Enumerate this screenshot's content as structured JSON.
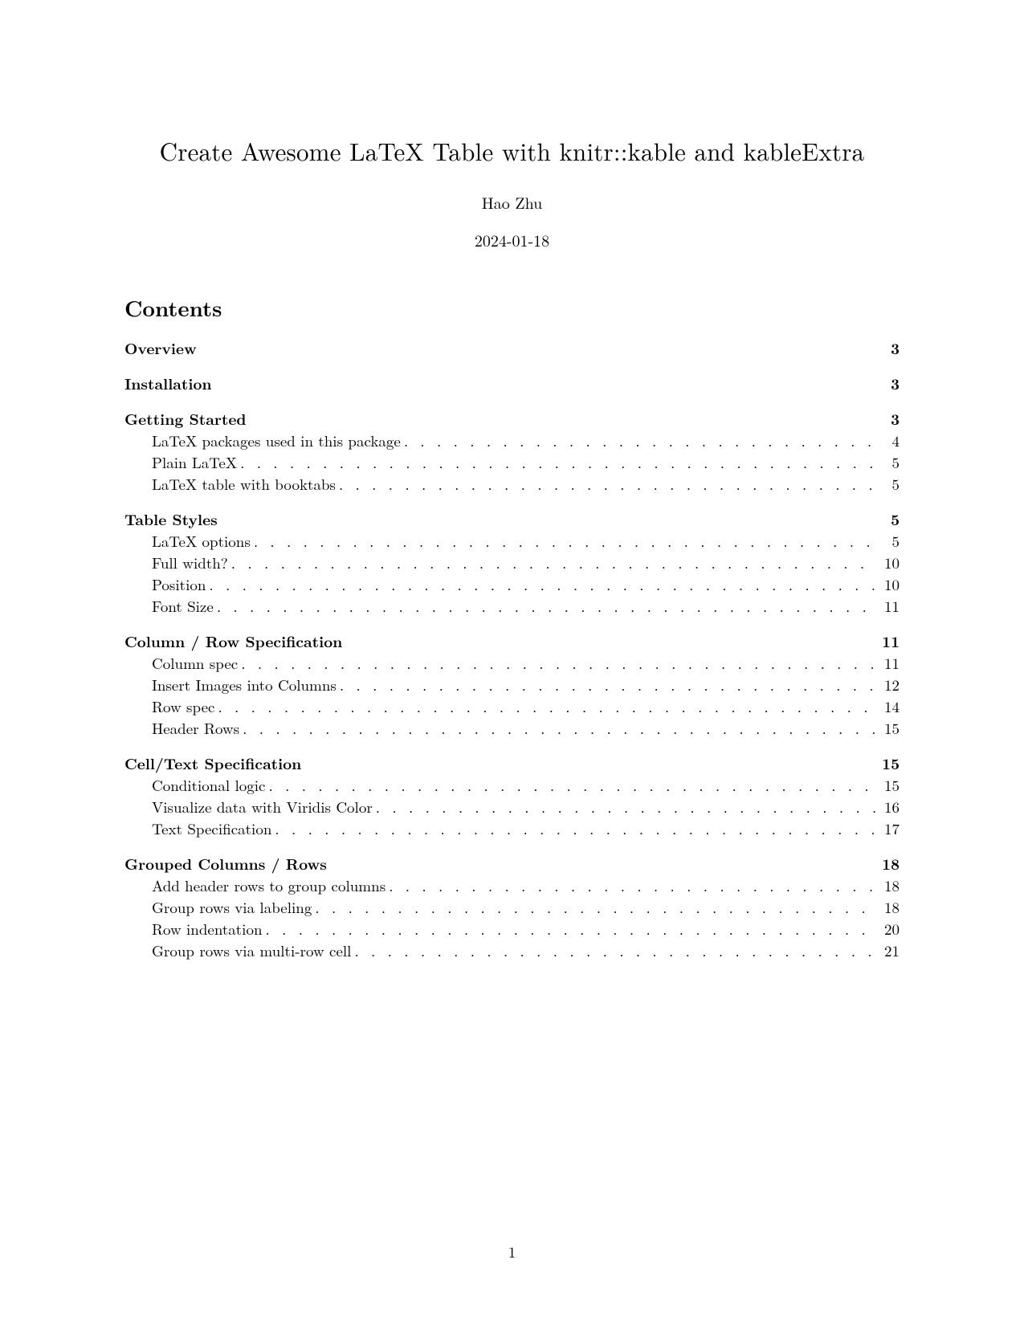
{
  "title": "Create Awesome LaTeX Table with knitr::kable and kableExtra",
  "author": "Hao Zhu",
  "date": "2024-01-18",
  "contents_heading": "Contents",
  "page_number": "1",
  "toc": [
    {
      "type": "section",
      "label": "Overview",
      "page": "3"
    },
    {
      "type": "section",
      "label": "Installation",
      "page": "3"
    },
    {
      "type": "section",
      "label": "Getting Started",
      "page": "3"
    },
    {
      "type": "sub",
      "label": "LaTeX packages used in this package",
      "page": "4"
    },
    {
      "type": "sub",
      "label": "Plain LaTeX",
      "page": "5"
    },
    {
      "type": "sub",
      "label": "LaTeX table with booktabs",
      "page": "5"
    },
    {
      "type": "section",
      "label": "Table Styles",
      "page": "5"
    },
    {
      "type": "sub",
      "label": "LaTeX options",
      "page": "5"
    },
    {
      "type": "sub",
      "label": "Full width?",
      "page": "10"
    },
    {
      "type": "sub",
      "label": "Position",
      "page": "10"
    },
    {
      "type": "sub",
      "label": "Font Size",
      "page": "11"
    },
    {
      "type": "section",
      "label": "Column / Row Specification",
      "page": "11"
    },
    {
      "type": "sub",
      "label": "Column spec",
      "page": "11"
    },
    {
      "type": "sub",
      "label": "Insert Images into Columns",
      "page": "12"
    },
    {
      "type": "sub",
      "label": "Row spec",
      "page": "14"
    },
    {
      "type": "sub",
      "label": "Header Rows",
      "page": "15"
    },
    {
      "type": "section",
      "label": "Cell/Text Specification",
      "page": "15"
    },
    {
      "type": "sub",
      "label": "Conditional logic",
      "page": "15"
    },
    {
      "type": "sub",
      "label": "Visualize data with Viridis Color",
      "page": "16"
    },
    {
      "type": "sub",
      "label": "Text Specification",
      "page": "17"
    },
    {
      "type": "section",
      "label": "Grouped Columns / Rows",
      "page": "18"
    },
    {
      "type": "sub",
      "label": "Add header rows to group columns",
      "page": "18"
    },
    {
      "type": "sub",
      "label": "Group rows via labeling",
      "page": "18"
    },
    {
      "type": "sub",
      "label": "Row indentation",
      "page": "20"
    },
    {
      "type": "sub",
      "label": "Group rows via multi-row cell",
      "page": "21"
    }
  ]
}
